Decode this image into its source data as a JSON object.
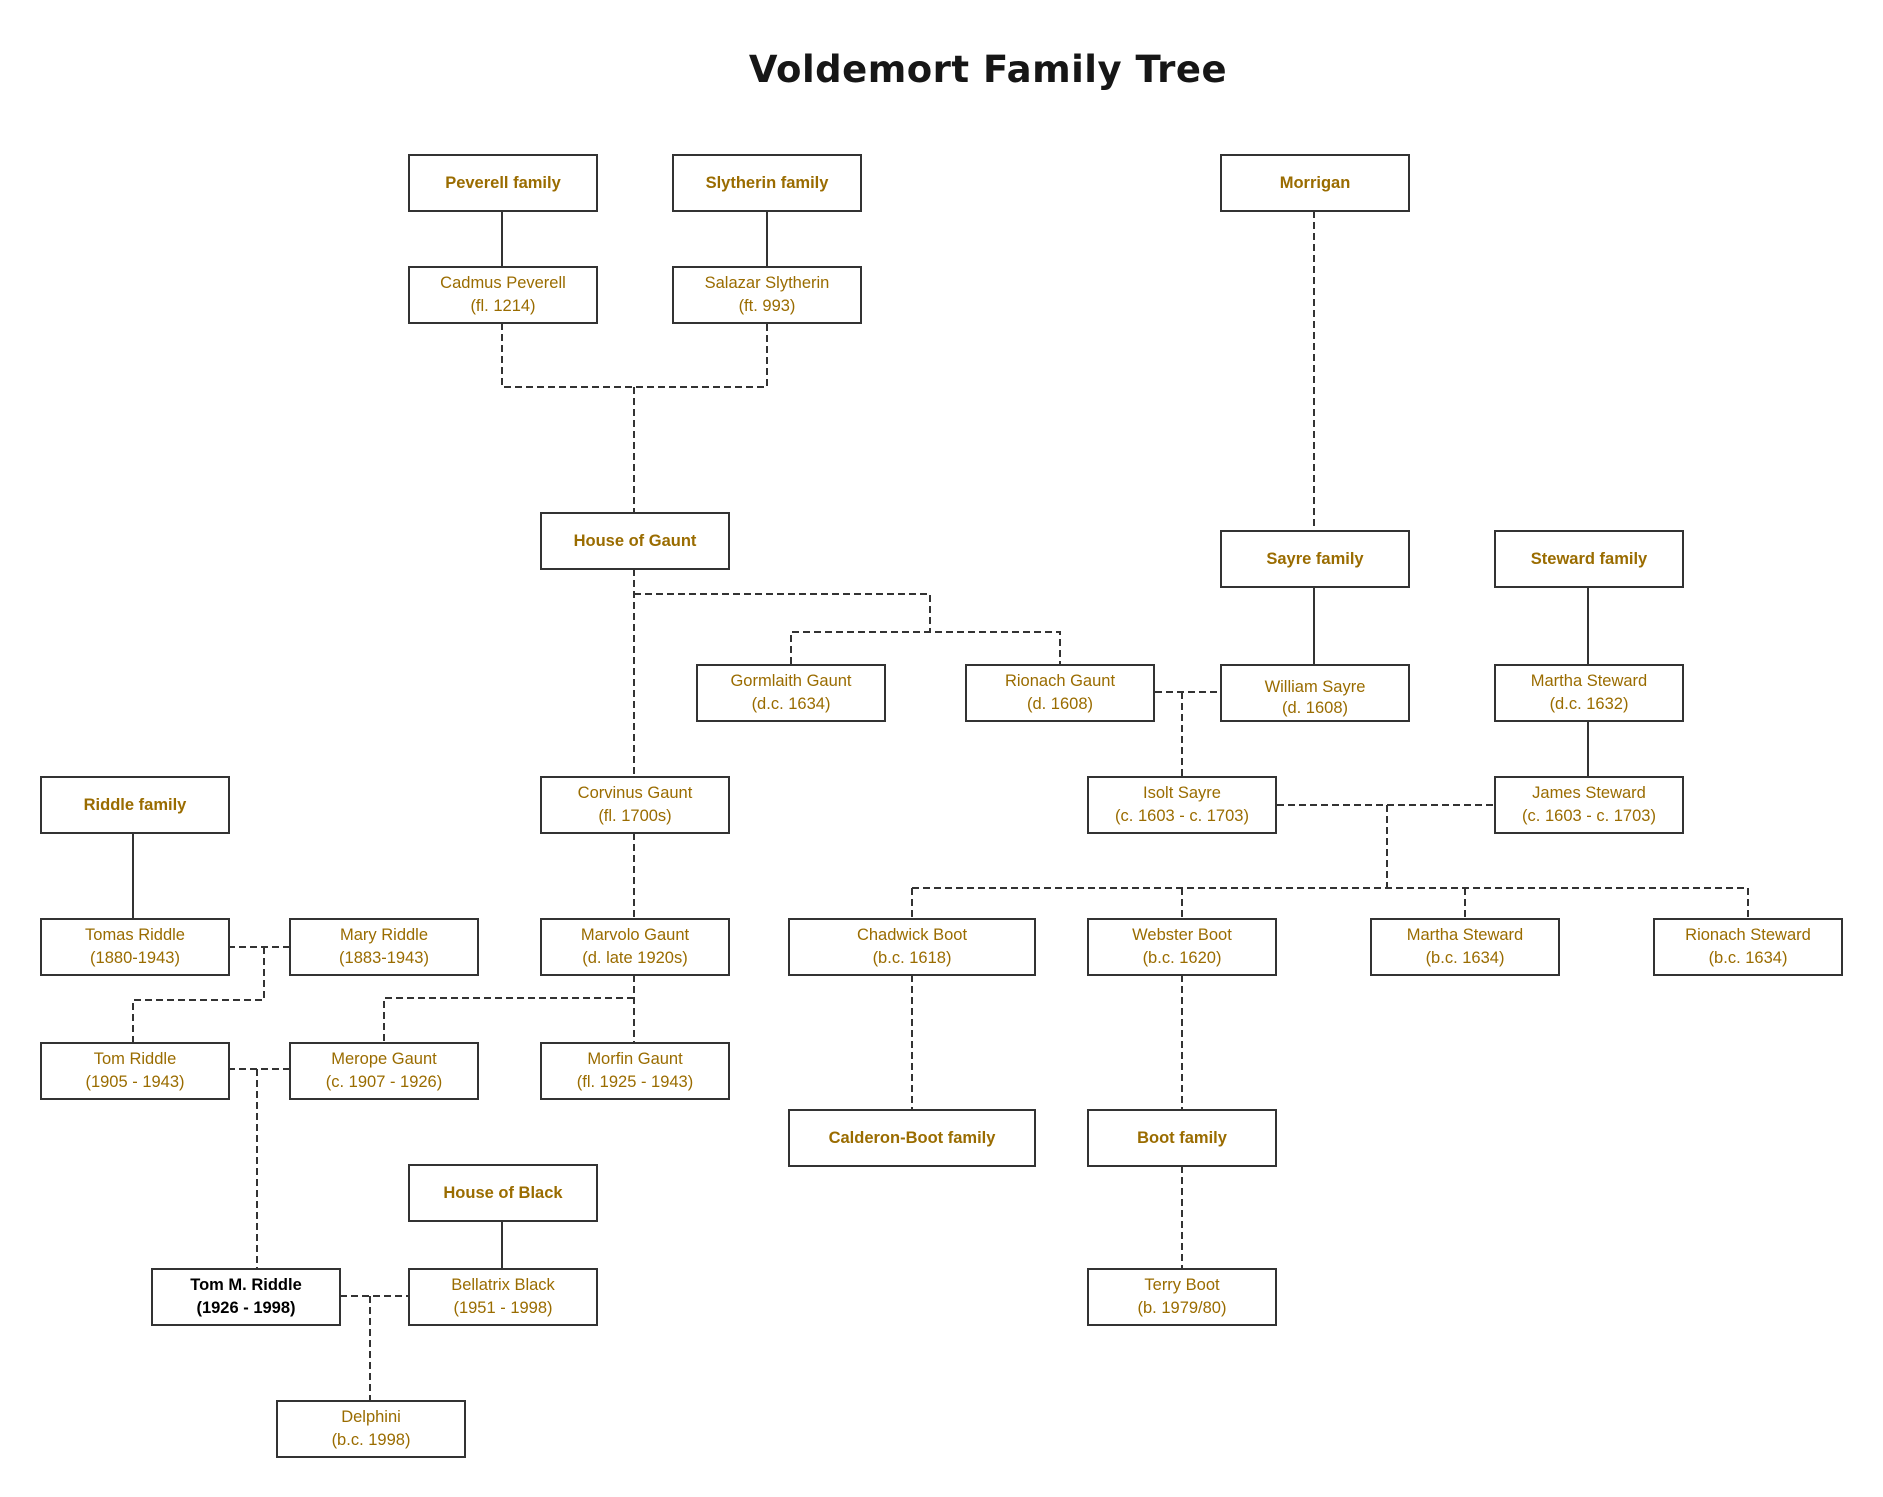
{
  "title": "Voldemort Family Tree",
  "colors": {
    "text": "#9a6c00",
    "focus_text": "#000000",
    "border": "#333333"
  },
  "nodes": {
    "peverell_family": {
      "name": "Peverell family"
    },
    "slytherin_family": {
      "name": "Slytherin family"
    },
    "morrigan": {
      "name": "Morrigan"
    },
    "cadmus_peverell": {
      "name": "Cadmus Peverell",
      "dates": "(fl. 1214)"
    },
    "salazar_slytherin": {
      "name": "Salazar Slytherin",
      "dates": "(ft. 993)"
    },
    "house_of_gaunt": {
      "name": "House of Gaunt"
    },
    "sayre_family": {
      "name": "Sayre family"
    },
    "steward_family": {
      "name": "Steward family"
    },
    "gormlaith_gaunt": {
      "name": "Gormlaith Gaunt",
      "dates": "(d.c. 1634)"
    },
    "rionach_gaunt": {
      "name": "Rionach Gaunt",
      "dates": "(d. 1608)"
    },
    "william_sayre": {
      "name": "William Sayre",
      "dates": "(d. 1608)"
    },
    "martha_steward_elder": {
      "name": "Martha Steward",
      "dates": "(d.c. 1632)"
    },
    "riddle_family": {
      "name": "Riddle family"
    },
    "corvinus_gaunt": {
      "name": "Corvinus Gaunt",
      "dates": "(fl. 1700s)"
    },
    "isolt_sayre": {
      "name": "Isolt Sayre",
      "dates": "(c. 1603 - c. 1703)"
    },
    "james_steward": {
      "name": "James Steward",
      "dates": "(c. 1603 - c. 1703)"
    },
    "tomas_riddle": {
      "name": "Tomas Riddle",
      "dates": "(1880-1943)"
    },
    "mary_riddle": {
      "name": "Mary Riddle",
      "dates": "(1883-1943)"
    },
    "marvolo_gaunt": {
      "name": "Marvolo Gaunt",
      "dates": "(d. late 1920s)"
    },
    "chadwick_boot": {
      "name": "Chadwick Boot",
      "dates": "(b.c. 1618)"
    },
    "webster_boot": {
      "name": "Webster Boot",
      "dates": "(b.c. 1620)"
    },
    "martha_steward_younger": {
      "name": "Martha Steward",
      "dates": "(b.c. 1634)"
    },
    "rionach_steward": {
      "name": "Rionach Steward",
      "dates": "(b.c. 1634)"
    },
    "tom_riddle_sr": {
      "name": "Tom Riddle",
      "dates": "(1905 - 1943)"
    },
    "merope_gaunt": {
      "name": "Merope Gaunt",
      "dates": "(c. 1907 - 1926)"
    },
    "morfin_gaunt": {
      "name": "Morfin Gaunt",
      "dates": "(fl. 1925 - 1943)"
    },
    "calderon_boot_family": {
      "name": "Calderon-Boot family"
    },
    "boot_family": {
      "name": "Boot family"
    },
    "house_of_black": {
      "name": "House of Black"
    },
    "tom_m_riddle": {
      "name": "Tom M. Riddle",
      "dates": "(1926 - 1998)"
    },
    "bellatrix_black": {
      "name": "Bellatrix Black",
      "dates": "(1951 - 1998)"
    },
    "terry_boot": {
      "name": "Terry Boot",
      "dates": "(b. 1979/80)"
    },
    "delphini": {
      "name": "Delphini",
      "dates": "(b.c. 1998)"
    }
  }
}
